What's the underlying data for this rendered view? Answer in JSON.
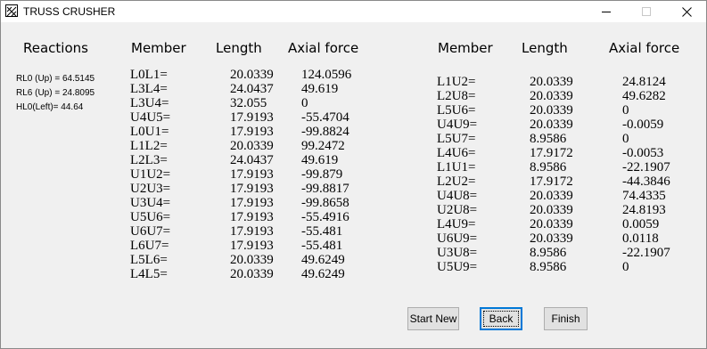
{
  "window": {
    "title": "TRUSS CRUSHER",
    "controls": {
      "minimize_icon": "minimize-icon",
      "maximize_icon": "maximize-icon",
      "close_icon": "close-icon"
    }
  },
  "reactions": {
    "header": "Reactions",
    "lines": [
      "RL0 (Up) = 64.5145",
      "RL6 (Up) = 24.8095",
      "HL0(Left)=  44.64"
    ]
  },
  "left_table": {
    "headers": {
      "member": "Member",
      "length": "Length",
      "axial": "Axial force"
    },
    "rows": [
      {
        "member": "L0L1=",
        "length": "20.0339",
        "axial": "124.0596"
      },
      {
        "member": "L3L4=",
        "length": "24.0437",
        "axial": "49.619"
      },
      {
        "member": "L3U4=",
        "length": "32.055",
        "axial": "0"
      },
      {
        "member": "U4U5=",
        "length": "17.9193",
        "axial": "-55.4704"
      },
      {
        "member": "L0U1=",
        "length": "17.9193",
        "axial": "-99.8824"
      },
      {
        "member": "L1L2=",
        "length": "20.0339",
        "axial": "99.2472"
      },
      {
        "member": "L2L3=",
        "length": "24.0437",
        "axial": "49.619"
      },
      {
        "member": "U1U2=",
        "length": "17.9193",
        "axial": "-99.879"
      },
      {
        "member": "U2U3=",
        "length": "17.9193",
        "axial": "-99.8817"
      },
      {
        "member": "U3U4=",
        "length": "17.9193",
        "axial": "-99.8658"
      },
      {
        "member": "U5U6=",
        "length": "17.9193",
        "axial": "-55.4916"
      },
      {
        "member": "U6U7=",
        "length": "17.9193",
        "axial": "-55.481"
      },
      {
        "member": "L6U7=",
        "length": "17.9193",
        "axial": "-55.481"
      },
      {
        "member": "L5L6=",
        "length": "20.0339",
        "axial": "49.6249"
      },
      {
        "member": "L4L5=",
        "length": "20.0339",
        "axial": "49.6249"
      }
    ]
  },
  "right_table": {
    "headers": {
      "member": "Member",
      "length": "Length",
      "axial": "Axial force"
    },
    "rows": [
      {
        "member": "L1U2=",
        "length": "20.0339",
        "axial": "24.8124"
      },
      {
        "member": "L2U8=",
        "length": "20.0339",
        "axial": "49.6282"
      },
      {
        "member": "L5U6=",
        "length": "20.0339",
        "axial": "0"
      },
      {
        "member": "U4U9=",
        "length": "20.0339",
        "axial": "-0.0059"
      },
      {
        "member": "L5U7=",
        "length": "8.9586",
        "axial": "0"
      },
      {
        "member": "L4U6=",
        "length": "17.9172",
        "axial": "-0.0053"
      },
      {
        "member": "L1U1=",
        "length": "8.9586",
        "axial": "-22.1907"
      },
      {
        "member": "L2U2=",
        "length": "17.9172",
        "axial": "-44.3846"
      },
      {
        "member": "U4U8=",
        "length": "20.0339",
        "axial": "74.4335"
      },
      {
        "member": "U2U8=",
        "length": "20.0339",
        "axial": "24.8193"
      },
      {
        "member": "L4U9=",
        "length": "20.0339",
        "axial": "0.0059"
      },
      {
        "member": "U6U9=",
        "length": "20.0339",
        "axial": "0.0118"
      },
      {
        "member": "U3U8=",
        "length": "8.9586",
        "axial": "-22.1907"
      },
      {
        "member": "U5U9=",
        "length": "8.9586",
        "axial": "0"
      }
    ]
  },
  "buttons": {
    "start_new": "Start New",
    "back": "Back",
    "finish": "Finish"
  }
}
